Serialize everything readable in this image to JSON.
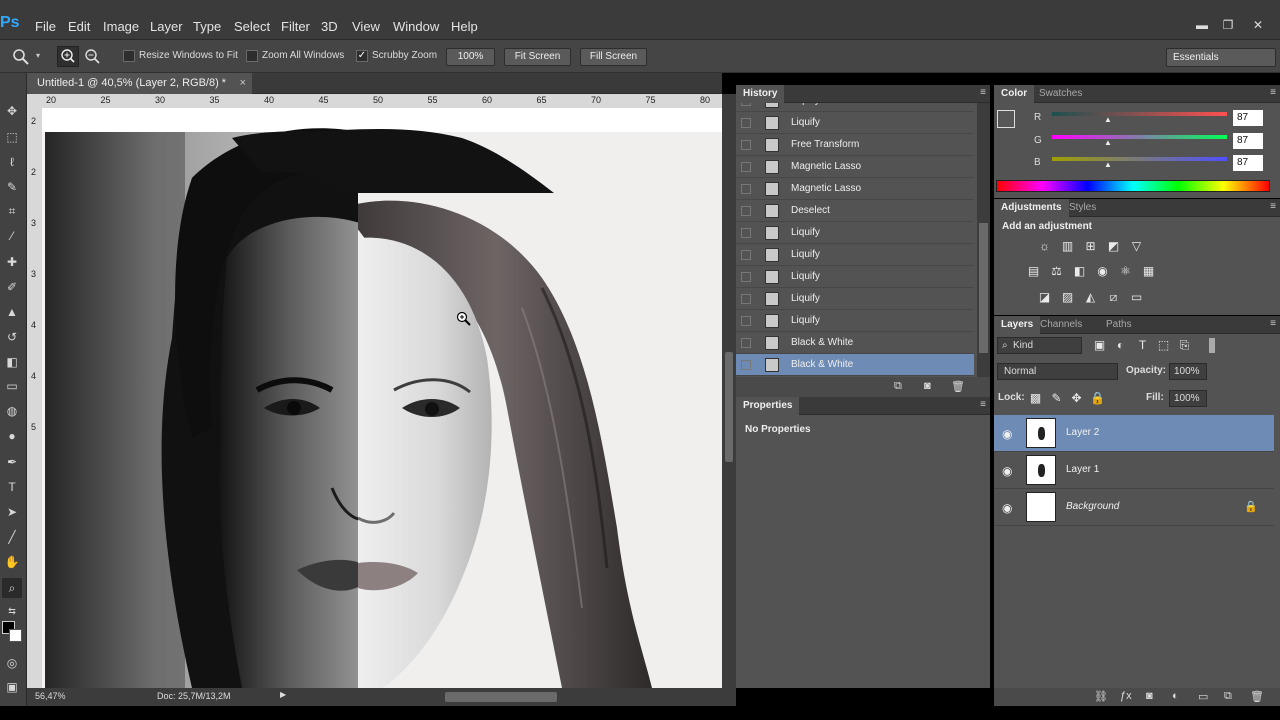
{
  "app": {
    "logo": "Ps"
  },
  "menu": [
    "File",
    "Edit",
    "Image",
    "Layer",
    "Type",
    "Select",
    "Filter",
    "3D",
    "View",
    "Window",
    "Help"
  ],
  "window_controls": {
    "minimize": "▬",
    "restore": "❐",
    "close": "✕"
  },
  "options": {
    "resize_windows_label": "Resize Windows to Fit",
    "zoom_all_label": "Zoom All Windows",
    "scrubby_label": "Scrubby Zoom",
    "scrubby_checked": true,
    "zoom_value": "100%",
    "fit_screen": "Fit Screen",
    "fill_screen": "Fill Screen",
    "workspace": "Essentials"
  },
  "document": {
    "tab_title": "Untitled-1 @ 40,5% (Layer 2, RGB/8) *",
    "ruler_h": [
      "20",
      "25",
      "30",
      "35",
      "40",
      "45",
      "50",
      "55",
      "60",
      "65",
      "70",
      "75",
      "80"
    ],
    "ruler_v": [
      "2",
      "2",
      "3",
      "3",
      "4",
      "4",
      "5"
    ],
    "zoom": "56,47%",
    "doc_size": "Doc: 25,7M/13,2M"
  },
  "history": {
    "tab": "History",
    "items": [
      {
        "label": "Liquify",
        "icon": "document-icon"
      },
      {
        "label": "Liquify",
        "icon": "document-icon"
      },
      {
        "label": "Free Transform",
        "icon": "document-icon"
      },
      {
        "label": "Magnetic Lasso",
        "icon": "lasso-icon"
      },
      {
        "label": "Magnetic Lasso",
        "icon": "lasso-icon"
      },
      {
        "label": "Deselect",
        "icon": "document-icon"
      },
      {
        "label": "Liquify",
        "icon": "document-icon"
      },
      {
        "label": "Liquify",
        "icon": "document-icon"
      },
      {
        "label": "Liquify",
        "icon": "document-icon"
      },
      {
        "label": "Liquify",
        "icon": "document-icon"
      },
      {
        "label": "Liquify",
        "icon": "document-icon"
      },
      {
        "label": "Black & White",
        "icon": "document-icon"
      },
      {
        "label": "Black & White",
        "icon": "document-icon",
        "selected": true
      }
    ]
  },
  "properties": {
    "tab": "Properties",
    "content": "No Properties"
  },
  "color": {
    "tabs": [
      "Color",
      "Swatches"
    ],
    "channels": [
      {
        "label": "R",
        "value": "87"
      },
      {
        "label": "G",
        "value": "87"
      },
      {
        "label": "B",
        "value": "87"
      }
    ],
    "swatch": "#575757"
  },
  "adjustments": {
    "tabs": [
      "Adjustments",
      "Styles"
    ],
    "title": "Add an adjustment"
  },
  "layers": {
    "tabs": [
      "Layers",
      "Channels",
      "Paths"
    ],
    "filter_kind": "Kind",
    "blend_mode": "Normal",
    "opacity_label": "Opacity:",
    "opacity": "100%",
    "lock_label": "Lock:",
    "fill_label": "Fill:",
    "fill": "100%",
    "items": [
      {
        "name": "Layer 2",
        "selected": true
      },
      {
        "name": "Layer 1"
      },
      {
        "name": "Background",
        "locked": true
      }
    ]
  },
  "colors": {
    "selection": "#6e8bb5",
    "panel_bg": "#535353",
    "accent": "#31a8ff"
  }
}
